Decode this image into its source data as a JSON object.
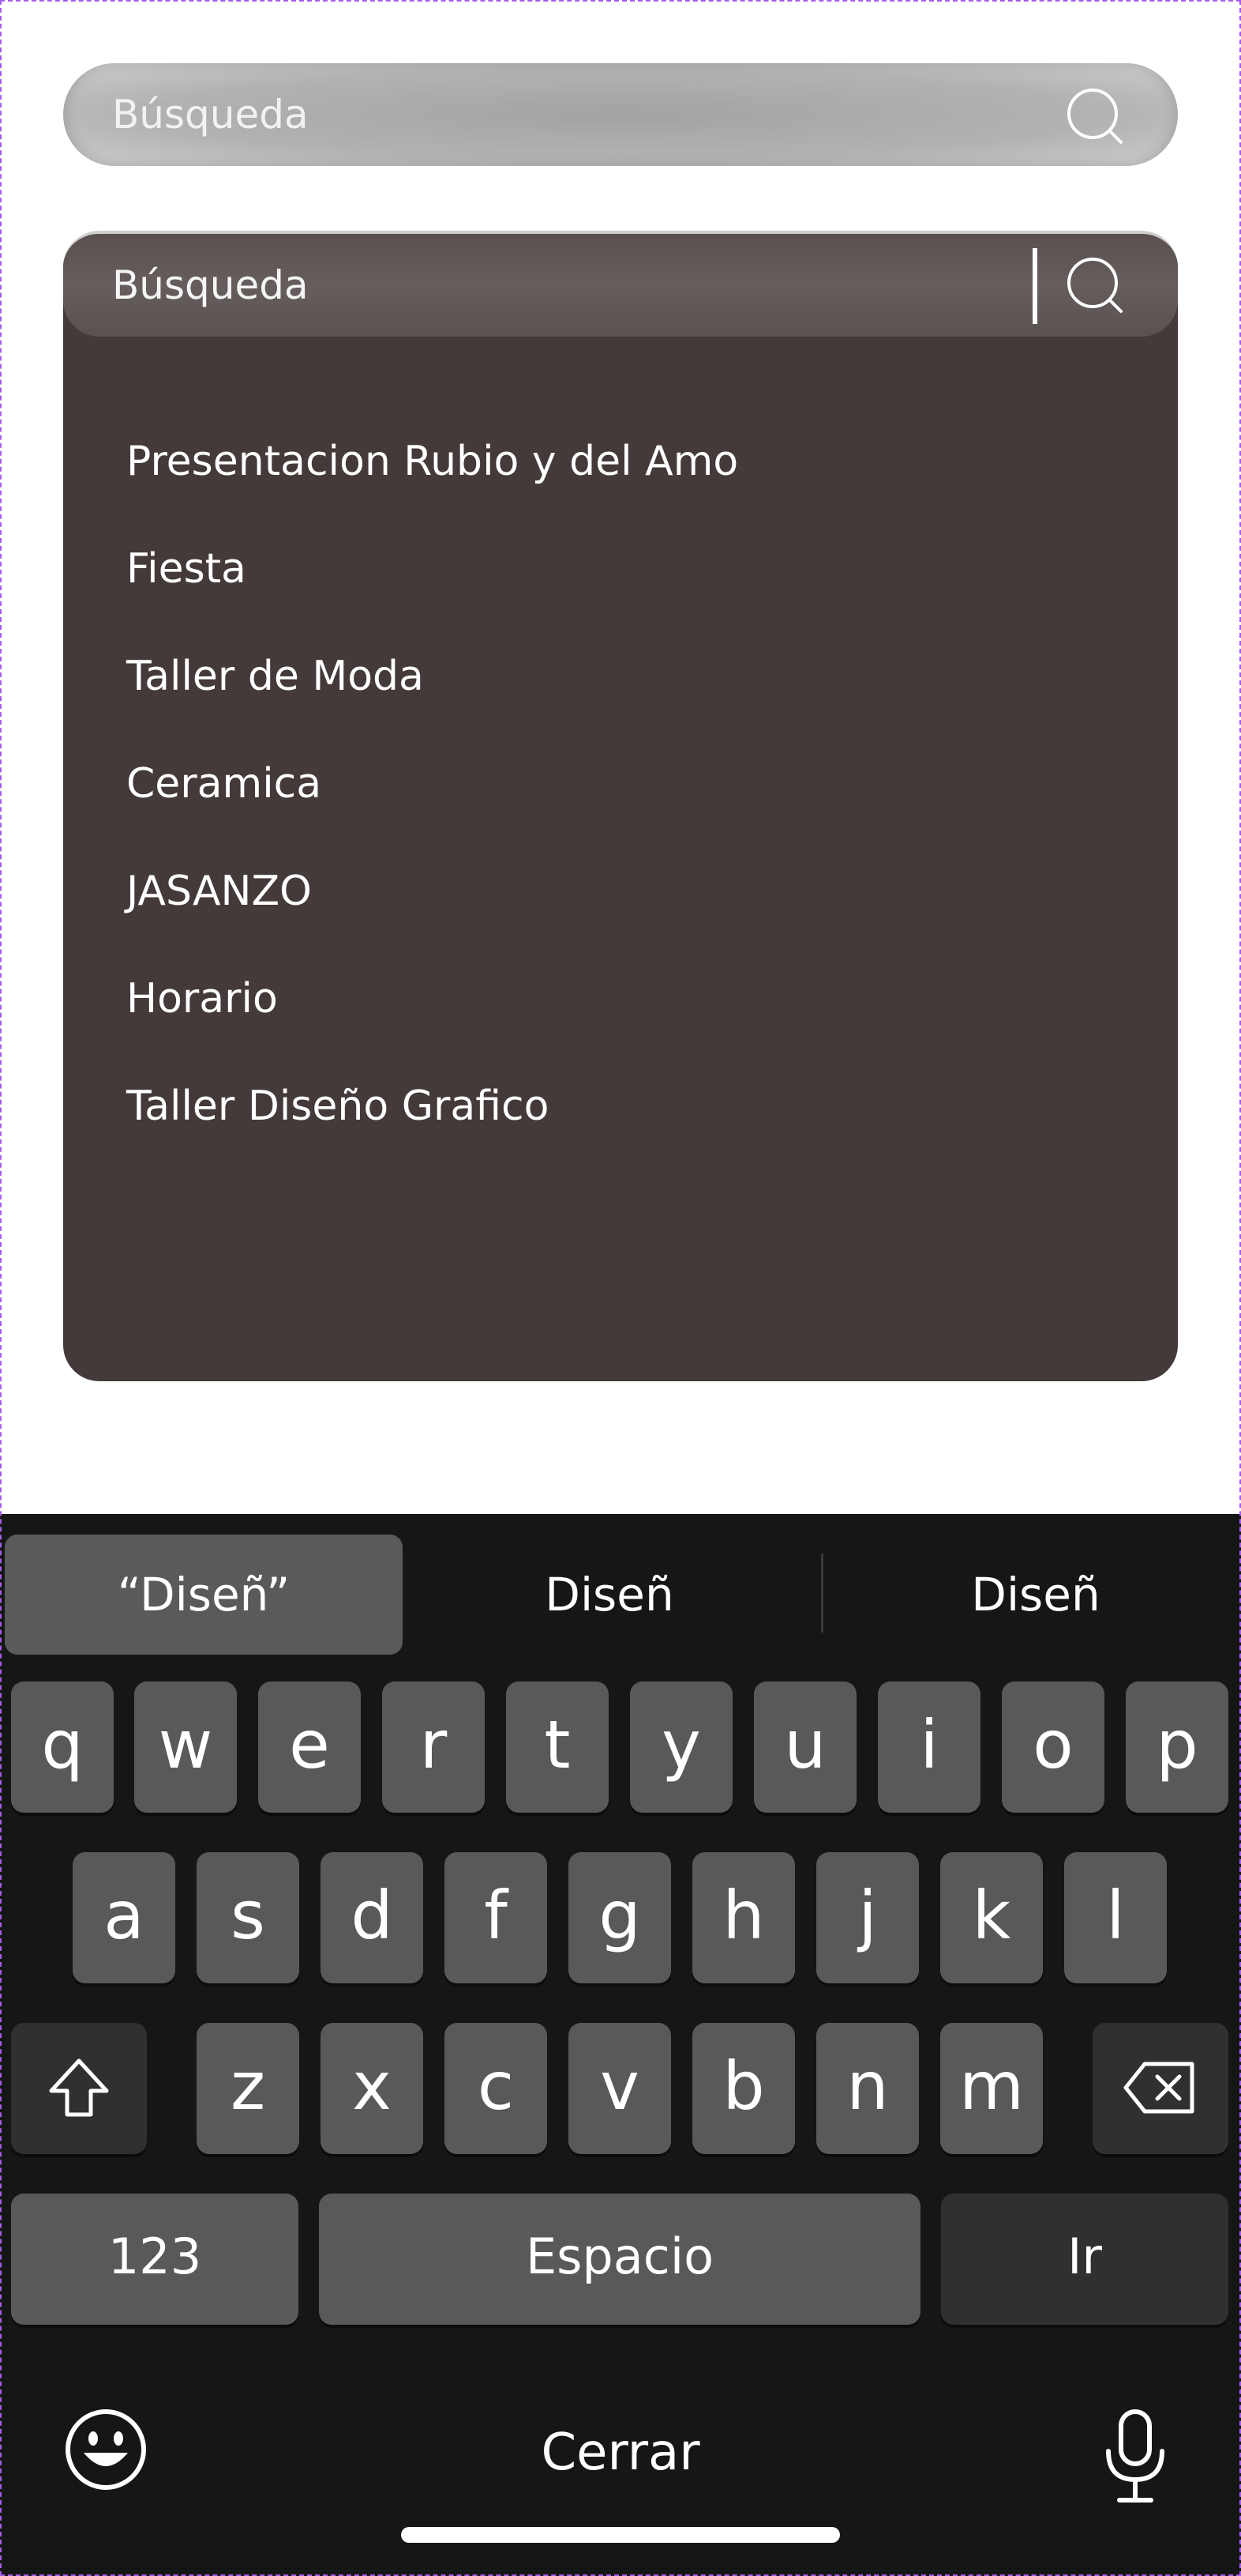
{
  "search_top": {
    "placeholder": "Búsqueda"
  },
  "search_active": {
    "value": "Búsqueda"
  },
  "results": [
    "Presentacion Rubio y del Amo",
    "Fiesta",
    "Taller de Moda",
    "Ceramica",
    "JASANZO",
    "Horario",
    "Taller Diseño Grafico"
  ],
  "keyboard": {
    "suggestions": [
      "“Diseñ”",
      "Diseñ",
      "Diseñ"
    ],
    "row1": [
      "q",
      "w",
      "e",
      "r",
      "t",
      "y",
      "u",
      "i",
      "o",
      "p"
    ],
    "row2": [
      "a",
      "s",
      "d",
      "f",
      "g",
      "h",
      "j",
      "k",
      "l"
    ],
    "row3": [
      "z",
      "x",
      "c",
      "v",
      "b",
      "n",
      "m"
    ],
    "numbers_label": "123",
    "space_label": "Espacio",
    "go_label": "Ir",
    "close_label": "Cerrar",
    "icons": [
      "shift-icon",
      "backspace-icon",
      "emoji-icon",
      "microphone-icon"
    ]
  },
  "colors": {
    "panel_bg": "#443a3a",
    "keyboard_bg": "#161616",
    "key_bg": "#595959",
    "frame_border": "#a55cf0"
  }
}
